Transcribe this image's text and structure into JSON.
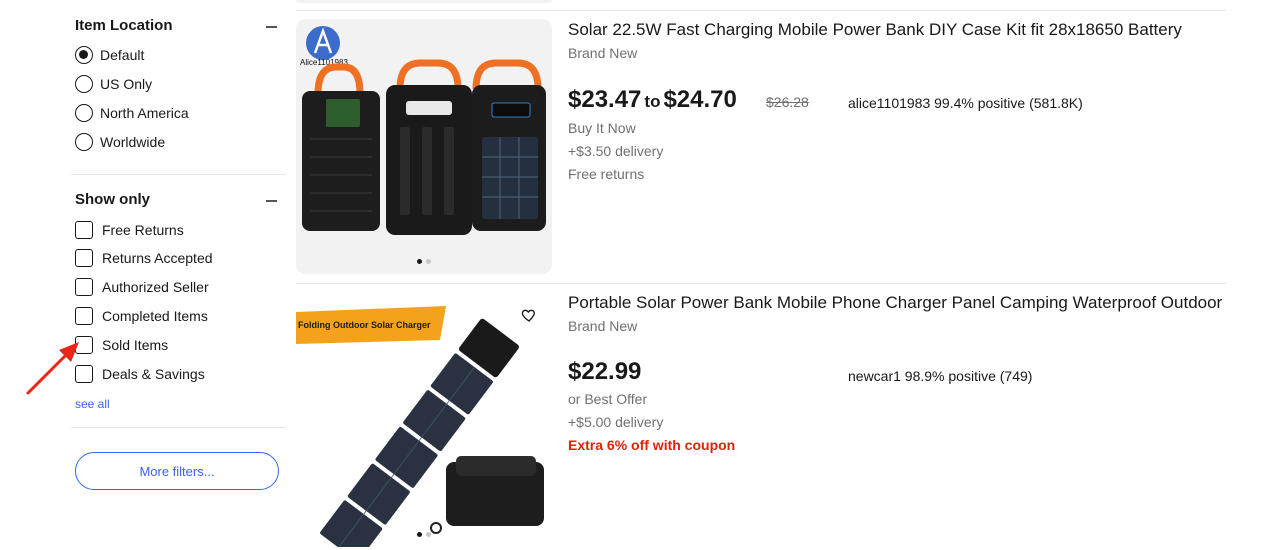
{
  "filters": {
    "location": {
      "title": "Item Location",
      "options": [
        "Default",
        "US Only",
        "North America",
        "Worldwide"
      ],
      "selected": "Default"
    },
    "show_only": {
      "title": "Show only",
      "options": [
        "Free Returns",
        "Returns Accepted",
        "Authorized Seller",
        "Completed Items",
        "Sold Items",
        "Deals & Savings"
      ]
    },
    "see_all": "see all",
    "more_filters": "More filters..."
  },
  "listings": [
    {
      "title": "Solar 22.5W Fast Charging Mobile Power Bank DIY Case Kit fit 28x18650 Battery",
      "condition": "Brand New",
      "price_low": "$23.47",
      "price_sep": "to",
      "price_high": "$24.70",
      "original_price": "$26.28",
      "buy_type": "Buy It Now",
      "delivery": "+$3.50 delivery",
      "returns": "Free returns",
      "seller": "alice1101983 99.4% positive (581.8K)",
      "image_watermark": "Alice1101983"
    },
    {
      "title": "Portable Solar Power Bank Mobile Phone Charger Panel Camping Waterproof Outdoor",
      "condition": "Brand New",
      "price": "$22.99",
      "buy_type": "or Best Offer",
      "delivery": "+$5.00 delivery",
      "coupon": "Extra 6% off with coupon",
      "seller": "newcar1 98.9% positive (749)",
      "image_banner": "Folding Outdoor Solar Charger"
    }
  ],
  "colors": {
    "link_blue": "#3665f3",
    "coupon_red": "#e0230a",
    "arrow_red": "#e8271a"
  }
}
